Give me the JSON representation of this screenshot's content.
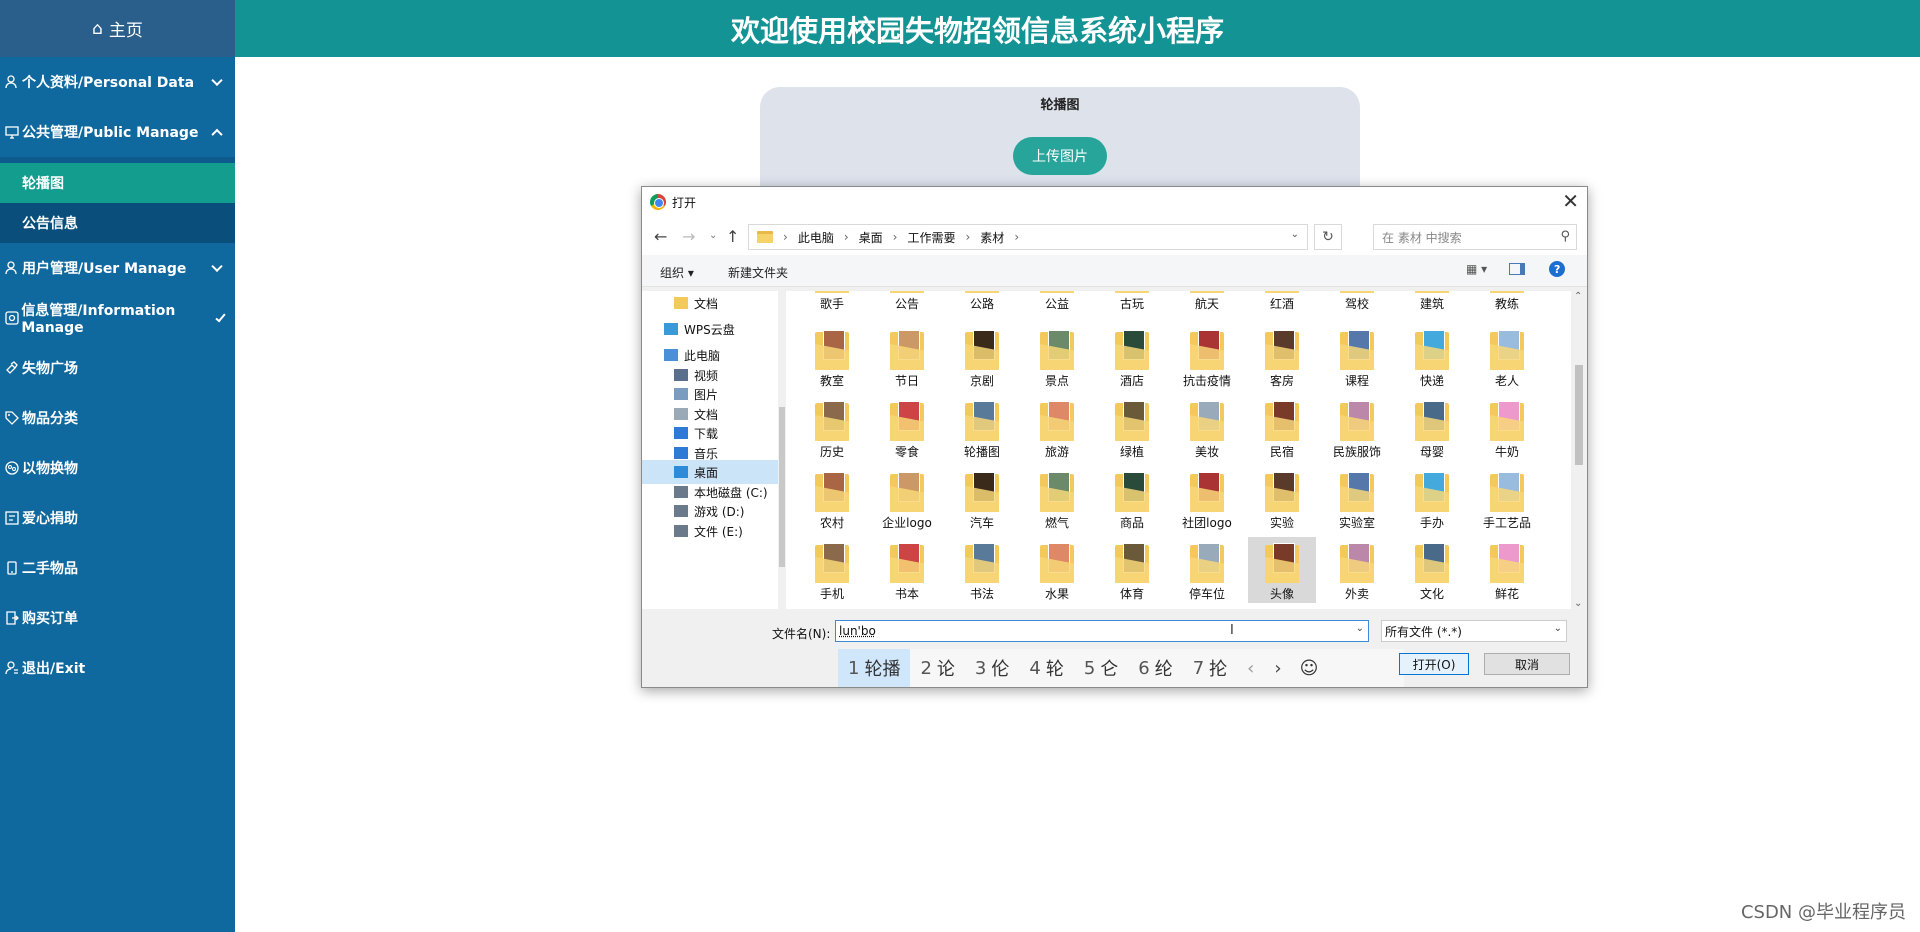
{
  "sidebar": {
    "home": "主页",
    "items": [
      {
        "label": "个人资料/Personal Data",
        "icon": "user-icon"
      },
      {
        "label": "公共管理/Public Manage",
        "icon": "monitor-icon"
      },
      {
        "label": "用户管理/User Manage",
        "icon": "user-icon"
      },
      {
        "label": "信息管理/Information Manage",
        "icon": "info-icon"
      },
      {
        "label": "失物广场",
        "icon": "link-icon"
      },
      {
        "label": "物品分类",
        "icon": "tag-icon"
      },
      {
        "label": "以物换物",
        "icon": "exchange-icon"
      },
      {
        "label": "爱心捐助",
        "icon": "list-icon"
      },
      {
        "label": "二手物品",
        "icon": "phone-icon"
      },
      {
        "label": "购买订单",
        "icon": "order-icon"
      },
      {
        "label": "退出/Exit",
        "icon": "exit-icon"
      }
    ],
    "sub_items": [
      {
        "label": "轮播图"
      },
      {
        "label": "公告信息"
      }
    ]
  },
  "header": {
    "title": "欢迎使用校园失物招领信息系统小程序"
  },
  "card": {
    "title": "轮播图",
    "upload_label": "上传图片"
  },
  "dialog": {
    "title": "打开",
    "breadcrumb": [
      "此电脑",
      "桌面",
      "工作需要",
      "素材"
    ],
    "search_placeholder": "在 素材 中搜索",
    "organize": "组织 ▾",
    "new_folder": "新建文件夹",
    "nav_items": [
      {
        "label": "文档",
        "color": "#f3c95c"
      },
      {
        "label": "WPS云盘",
        "color": "#3a9ad9"
      },
      {
        "label": "此电脑",
        "color": "#4a90d9"
      },
      {
        "label": "视频",
        "color": "#5a6f8c"
      },
      {
        "label": "图片",
        "color": "#7a9cc0"
      },
      {
        "label": "文档",
        "color": "#9aa9b8"
      },
      {
        "label": "下载",
        "color": "#2f7ad6"
      },
      {
        "label": "音乐",
        "color": "#2f7ad6"
      },
      {
        "label": "桌面",
        "color": "#2f8ad8"
      },
      {
        "label": "本地磁盘 (C:)",
        "color": "#6a7a8a"
      },
      {
        "label": "游戏 (D:)",
        "color": "#6a7a8a"
      },
      {
        "label": "文件 (E:)",
        "color": "#6a7a8a"
      }
    ],
    "folders": [
      "歌手",
      "公告",
      "公路",
      "公益",
      "古玩",
      "航天",
      "红酒",
      "驾校",
      "建筑",
      "教练",
      "教室",
      "节日",
      "京剧",
      "景点",
      "酒店",
      "抗击疫情",
      "客房",
      "课程",
      "快递",
      "老人",
      "历史",
      "零食",
      "轮播图",
      "旅游",
      "绿植",
      "美妆",
      "民宿",
      "民族服饰",
      "母婴",
      "牛奶",
      "农村",
      "企业logo",
      "汽车",
      "燃气",
      "商品",
      "社团logo",
      "实验",
      "实验室",
      "手办",
      "手工艺品",
      "手机",
      "书本",
      "书法",
      "水果",
      "体育",
      "停车位",
      "头像",
      "外卖",
      "文化",
      "鲜花"
    ],
    "filename_label": "文件名(N):",
    "filename_value": "lun'bo",
    "filetype": "所有文件 (*.*)",
    "open_label": "打开(O)",
    "cancel_label": "取消",
    "ime_candidates": [
      {
        "n": "1",
        "c": "轮播"
      },
      {
        "n": "2",
        "c": "论"
      },
      {
        "n": "3",
        "c": "伦"
      },
      {
        "n": "4",
        "c": "轮"
      },
      {
        "n": "5",
        "c": "仑"
      },
      {
        "n": "6",
        "c": "纶"
      },
      {
        "n": "7",
        "c": "抡"
      }
    ]
  },
  "watermark": "CSDN @毕业程序员"
}
